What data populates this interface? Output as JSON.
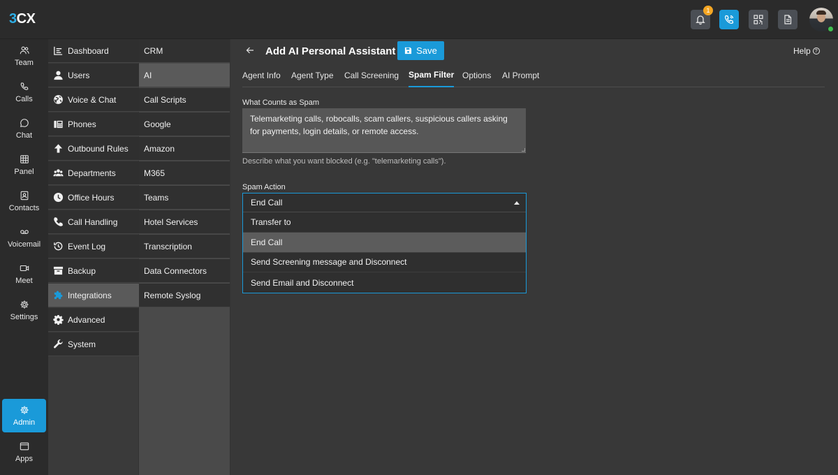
{
  "brand": {
    "logo_three": "3",
    "logo_cx": "CX"
  },
  "topbar": {
    "notification_count": "1"
  },
  "rail": [
    {
      "label": "Team",
      "icon": "team-icon"
    },
    {
      "label": "Calls",
      "icon": "phone-icon"
    },
    {
      "label": "Chat",
      "icon": "chat-icon"
    },
    {
      "label": "Panel",
      "icon": "grid-icon"
    },
    {
      "label": "Contacts",
      "icon": "contacts-icon"
    },
    {
      "label": "Voicemail",
      "icon": "voicemail-icon"
    },
    {
      "label": "Meet",
      "icon": "video-icon"
    },
    {
      "label": "Settings",
      "icon": "gear-icon"
    },
    {
      "label": "Admin",
      "icon": "admin-gear-icon",
      "active": true
    },
    {
      "label": "Apps",
      "icon": "apps-icon"
    }
  ],
  "admin_menu": [
    {
      "label": "Dashboard",
      "icon": "dashboard-icon"
    },
    {
      "label": "Users",
      "icon": "user-icon"
    },
    {
      "label": "Voice & Chat",
      "icon": "globe-icon"
    },
    {
      "label": "Phones",
      "icon": "fax-phone-icon"
    },
    {
      "label": "Outbound Rules",
      "icon": "arrow-up-icon"
    },
    {
      "label": "Departments",
      "icon": "departments-icon"
    },
    {
      "label": "Office Hours",
      "icon": "clock-icon"
    },
    {
      "label": "Call Handling",
      "icon": "handset-icon"
    },
    {
      "label": "Event Log",
      "icon": "history-icon"
    },
    {
      "label": "Backup",
      "icon": "archive-icon"
    },
    {
      "label": "Integrations",
      "icon": "puzzle-icon",
      "active": true
    },
    {
      "label": "Advanced",
      "icon": "cog-icon"
    },
    {
      "label": "System",
      "icon": "wrench-icon"
    }
  ],
  "integrations_menu": [
    {
      "label": "CRM"
    },
    {
      "label": "AI",
      "active": true
    },
    {
      "label": "Call Scripts"
    },
    {
      "label": "Google"
    },
    {
      "label": "Amazon"
    },
    {
      "label": "M365"
    },
    {
      "label": "Teams"
    },
    {
      "label": "Hotel Services"
    },
    {
      "label": "Transcription"
    },
    {
      "label": "Data Connectors"
    },
    {
      "label": "Remote Syslog"
    }
  ],
  "header": {
    "title": "Add AI Personal Assistant",
    "save_label": "Save",
    "help_label": "Help"
  },
  "tabs": [
    {
      "label": "Agent Info"
    },
    {
      "label": "Agent Type"
    },
    {
      "label": "Call Screening"
    },
    {
      "label": "Spam Filter",
      "active": true
    },
    {
      "label": "Options"
    },
    {
      "label": "AI Prompt"
    }
  ],
  "spam_form": {
    "what_counts_label": "What Counts as Spam",
    "what_counts_value": "Telemarketing calls, robocalls, scam callers, suspicious callers asking for payments, login details, or remote access.",
    "what_counts_helper": "Describe what you want blocked (e.g. \"telemarketing calls\").",
    "spam_action_label": "Spam Action",
    "spam_action_value": "End Call",
    "spam_action_options": [
      {
        "label": "Transfer to"
      },
      {
        "label": "End Call",
        "selected": true
      },
      {
        "label": "Send Screening message and Disconnect"
      },
      {
        "label": "Send Email and Disconnect"
      }
    ]
  },
  "colors": {
    "accent": "#1a9ad9",
    "badge": "#f5a623",
    "online": "#3fbf4f"
  }
}
